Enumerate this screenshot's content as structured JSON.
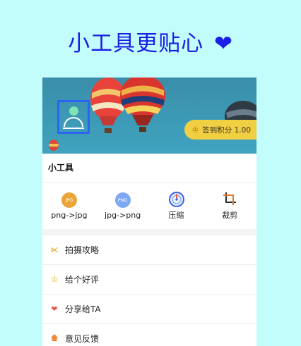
{
  "header": {
    "title": "小工具更贴心",
    "heart": "❤"
  },
  "banner": {
    "signin_label": "签到积分 1.00"
  },
  "tools_section": {
    "label": "小工具",
    "items": [
      {
        "label": "png->jpg",
        "badge": "JPG",
        "icon": "jpg-icon"
      },
      {
        "label": "jpg->png",
        "badge": "PNG",
        "icon": "png-icon"
      },
      {
        "label": "压缩",
        "icon": "compress-gauge-icon"
      },
      {
        "label": "裁剪",
        "icon": "crop-icon"
      }
    ]
  },
  "menu": [
    {
      "label": "拍摄攻略",
      "icon": "guide-icon",
      "color": "#e8b43a"
    },
    {
      "label": "给个好评",
      "icon": "crown-icon",
      "color": "#e6b73c"
    },
    {
      "label": "分享给TA",
      "icon": "heart-icon",
      "color": "#e05a4e"
    },
    {
      "label": "意见反馈",
      "icon": "home-icon",
      "color": "#ee8a3c"
    }
  ]
}
